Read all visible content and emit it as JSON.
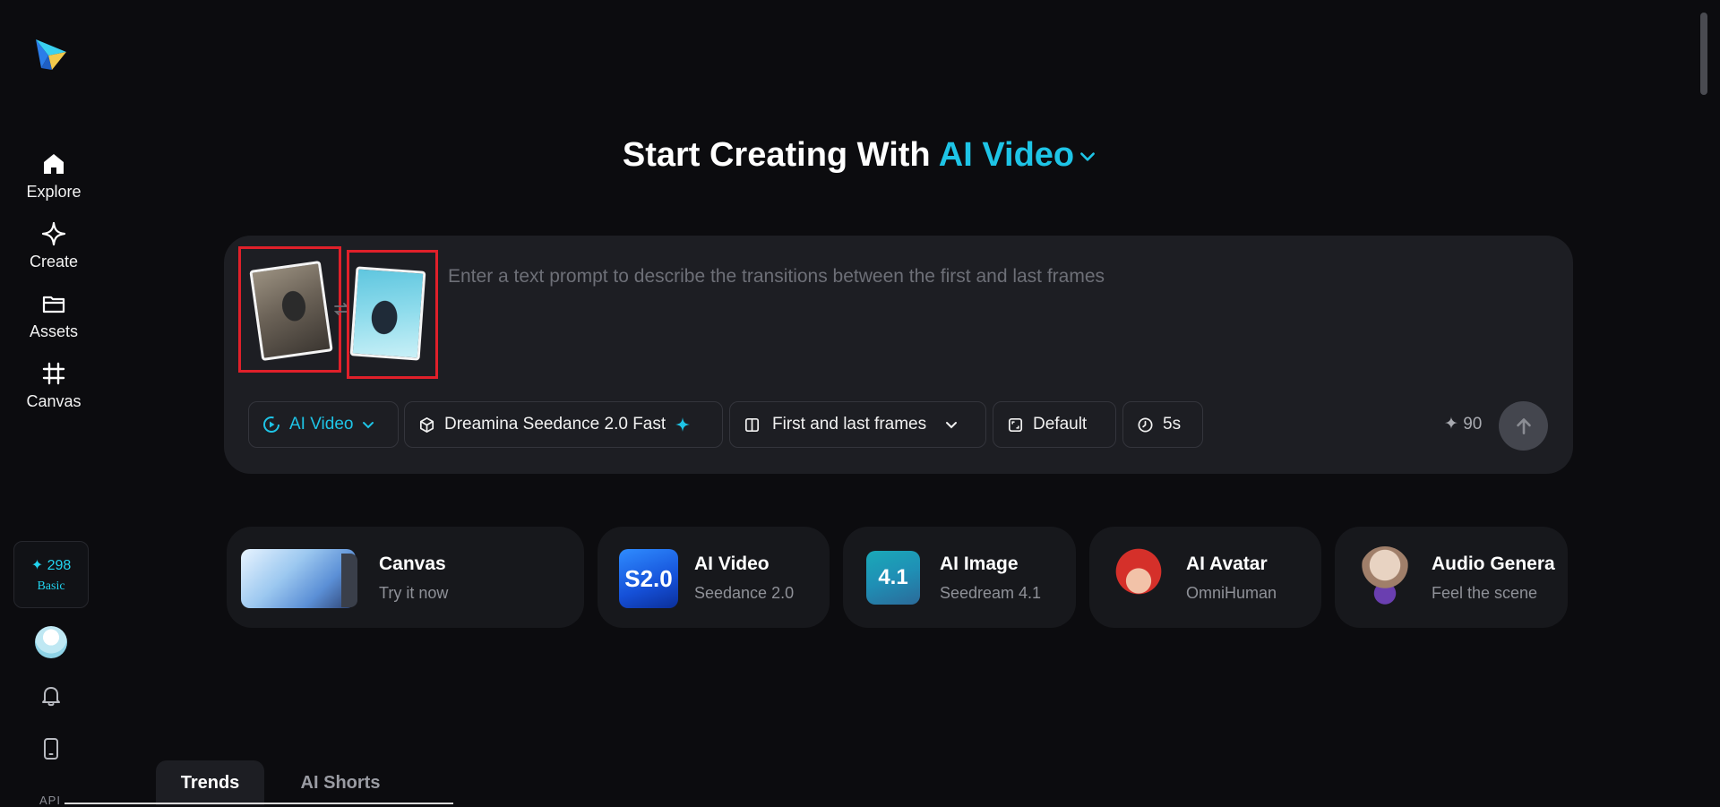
{
  "sidebar": {
    "items": [
      {
        "label": "Explore",
        "icon": "home-icon"
      },
      {
        "label": "Create",
        "icon": "sparkle-icon"
      },
      {
        "label": "Assets",
        "icon": "folder-icon"
      },
      {
        "label": "Canvas",
        "icon": "frame-icon"
      }
    ],
    "credits": "✦ 298",
    "plan": "Basic",
    "api_label": "API"
  },
  "hero": {
    "title_prefix": "Start Creating With",
    "title_accent": "AI Video"
  },
  "prompt": {
    "placeholder": "Enter a text prompt to describe the transitions between the first and last frames",
    "toolbar": {
      "mode_label": "AI Video",
      "model_label": "Dreamina Seedance 2.0 Fast",
      "frames_label": "First and last frames",
      "ratio_label": "Default",
      "duration_label": "5s",
      "cost": "90"
    }
  },
  "features": [
    {
      "title": "Canvas",
      "subtitle": "Try it now"
    },
    {
      "title": "AI Video",
      "subtitle": "Seedance 2.0",
      "badge": "S2.0"
    },
    {
      "title": "AI Image",
      "subtitle": "Seedream 4.1",
      "badge": "4.1"
    },
    {
      "title": "AI Avatar",
      "subtitle": "OmniHuman"
    },
    {
      "title": "Audio Genera",
      "subtitle": "Feel the scene"
    }
  ],
  "tabs": [
    {
      "label": "Trends",
      "active": true
    },
    {
      "label": "AI Shorts",
      "active": false
    }
  ],
  "colors": {
    "accent": "#1ec4e6",
    "background": "#0c0c0f",
    "card": "#1d1e23",
    "highlight_border": "#e0202a"
  }
}
